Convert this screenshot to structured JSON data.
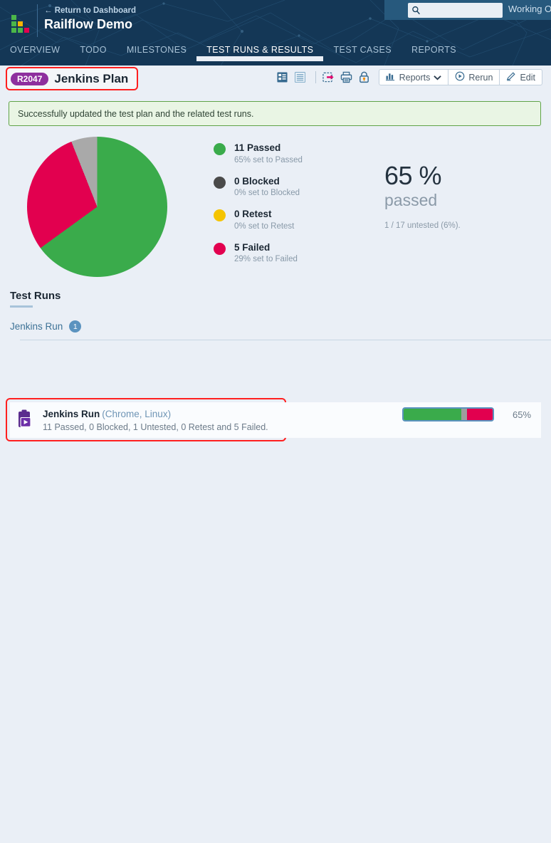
{
  "header": {
    "return_link": "← Return to Dashboard",
    "project_title": "Railflow Demo",
    "search": {
      "placeholder": "",
      "value": "",
      "icon": "search-icon"
    },
    "working_on": "Working O",
    "logo_icon": "railflow-logo-icon",
    "tabs": [
      {
        "label": "OVERVIEW",
        "active": false
      },
      {
        "label": "TODO",
        "active": false
      },
      {
        "label": "MILESTONES",
        "active": false
      },
      {
        "label": "TEST RUNS & RESULTS",
        "active": true
      },
      {
        "label": "TEST CASES",
        "active": false
      },
      {
        "label": "REPORTS",
        "active": false
      }
    ]
  },
  "title_bar": {
    "badge": "R2047",
    "badge_color": "#8e2f9e",
    "plan_name": "Jenkins Plan",
    "highlight_color": "#ff1f1f",
    "toolbar": {
      "icons": [
        {
          "name": "layout-grid-icon",
          "active": true
        },
        {
          "name": "layout-list-icon",
          "active": false
        },
        {
          "name": "export-icon",
          "active": false
        },
        {
          "name": "print-icon",
          "active": false
        },
        {
          "name": "lock-icon",
          "active": false
        }
      ],
      "reports_label": "Reports",
      "rerun_label": "Rerun",
      "edit_label": "Edit"
    }
  },
  "alert": {
    "message": "Successfully updated the test plan and the related test runs.",
    "bg": "#e9f5e4",
    "border": "#5fa347"
  },
  "summary": {
    "legend": [
      {
        "color": "#3aab4b",
        "count_label": "11 Passed",
        "sub_label": "65% set to Passed"
      },
      {
        "color": "#4a4a4a",
        "count_label": "0 Blocked",
        "sub_label": "0% set to Blocked"
      },
      {
        "color": "#f5c400",
        "count_label": "0 Retest",
        "sub_label": "0% set to Retest"
      },
      {
        "color": "#e2004f",
        "count_label": "5 Failed",
        "sub_label": "29% set to Failed"
      }
    ],
    "big_percent": "65 %",
    "big_word": "passed",
    "note": "1 / 17 untested (6%)."
  },
  "chart_data": {
    "type": "pie",
    "title": "",
    "labels": [
      "Passed",
      "Failed",
      "Untested"
    ],
    "values": [
      65,
      29,
      6
    ],
    "colors": [
      "#3aab4b",
      "#e2004f",
      "#a9a9a9"
    ],
    "units": "percent",
    "counts": [
      11,
      5,
      1
    ],
    "total": 17,
    "legend_position": "right",
    "start_angle": 0
  },
  "test_runs": {
    "section_title": "Test Runs",
    "group": {
      "name": "Jenkins Run",
      "count": "1"
    },
    "rows": [
      {
        "icon": "test-run-play-icon",
        "title": "Jenkins Run",
        "config": "(Chrome, Linux)",
        "summary": "11 Passed, 0 Blocked, 1 Untested, 0 Retest and 5 Failed.",
        "progress": {
          "passed": 65,
          "untested": 6,
          "failed": 29
        },
        "percent_label": "65%"
      }
    ]
  }
}
